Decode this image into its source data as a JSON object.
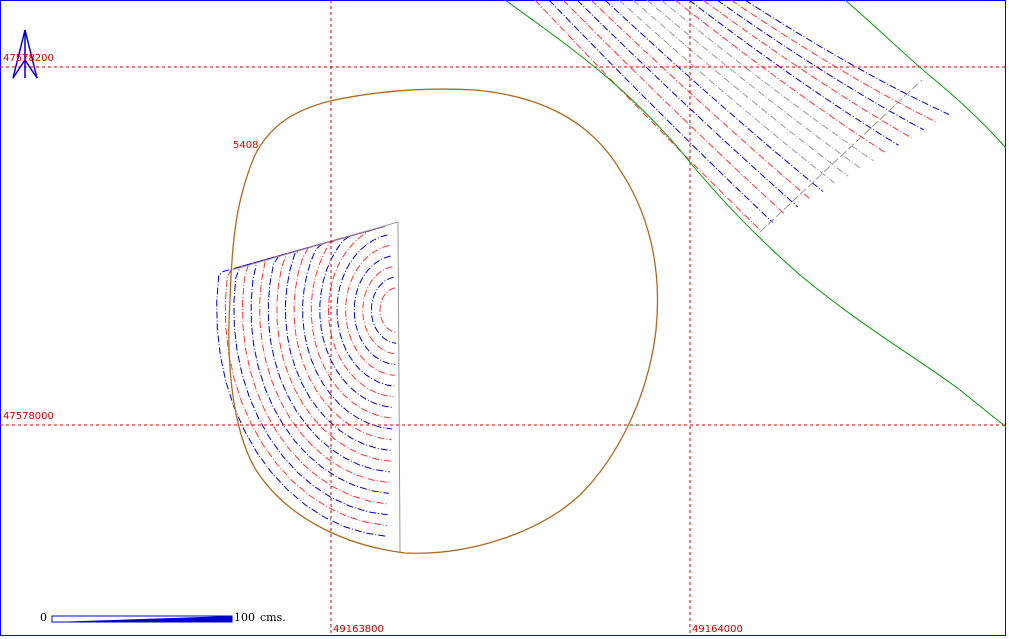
{
  "map": {
    "grid": {
      "easting_labels": [
        "49163800",
        "49164000"
      ],
      "northing_labels": [
        "47578200",
        "47578000"
      ],
      "line_color": "#cc0000",
      "line_style": "dashed"
    },
    "north_arrow": {
      "icon": "north-arrow-icon",
      "color": "#0000cc"
    },
    "contours": {
      "index_color": "#0000cc",
      "intermediate_color": "#ff3333",
      "supplementary_color": "#999999",
      "style": "dash-dot"
    },
    "boundary": {
      "label": "5408",
      "color": "#b06a20"
    },
    "road_edge": {
      "color": "#009900"
    },
    "scale_bar": {
      "start_label": "0",
      "end_label": "100",
      "unit_label": "cms.",
      "color": "#0000cc"
    }
  }
}
